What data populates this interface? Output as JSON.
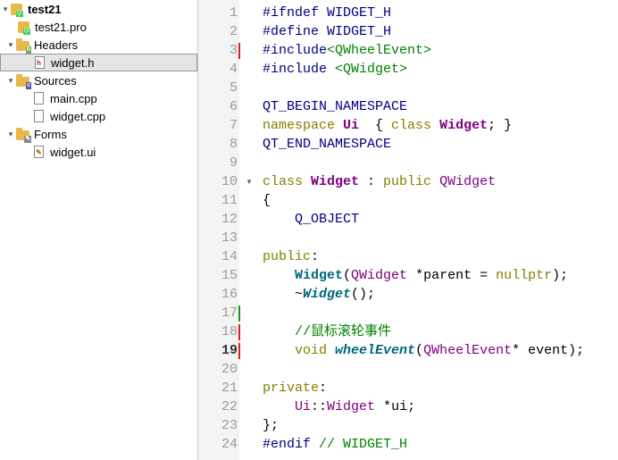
{
  "tree": {
    "project": "test21",
    "pro_file": "test21.pro",
    "headers_label": "Headers",
    "header_file": "widget.h",
    "sources_label": "Sources",
    "source_files": [
      "main.cpp",
      "widget.cpp"
    ],
    "forms_label": "Forms",
    "form_file": "widget.ui"
  },
  "editor": {
    "line_numbers": [
      "1",
      "2",
      "3",
      "4",
      "5",
      "6",
      "7",
      "8",
      "9",
      "10",
      "11",
      "12",
      "13",
      "14",
      "15",
      "16",
      "17",
      "18",
      "19",
      "20",
      "21",
      "22",
      "23",
      "24"
    ],
    "current_line": 19,
    "modified_lines_red": [
      3,
      18,
      19
    ],
    "added_lines_green": [
      17
    ],
    "fold_marker_line": 10,
    "lines": [
      [
        [
          "pp",
          "#ifndef WIDGET_H"
        ]
      ],
      [
        [
          "pp",
          "#define WIDGET_H"
        ]
      ],
      [
        [
          "pp",
          "#include"
        ],
        [
          "str",
          "<QWheelEvent>"
        ]
      ],
      [
        [
          "pp",
          "#include "
        ],
        [
          "str",
          "<QWidget>"
        ]
      ],
      [],
      [
        [
          "mac",
          "QT_BEGIN_NAMESPACE"
        ]
      ],
      [
        [
          "kw",
          "namespace "
        ],
        [
          "ty",
          "Ui"
        ],
        [
          "",
          "  { "
        ],
        [
          "kw",
          "class "
        ],
        [
          "ty",
          "Widget"
        ],
        [
          "",
          "; }"
        ]
      ],
      [
        [
          "mac",
          "QT_END_NAMESPACE"
        ]
      ],
      [],
      [
        [
          "kw",
          "class "
        ],
        [
          "ty",
          "Widget"
        ],
        [
          "",
          " : "
        ],
        [
          "kw",
          "public "
        ],
        [
          "cl",
          "QWidget"
        ]
      ],
      [
        [
          "",
          "{"
        ]
      ],
      [
        [
          "",
          "    "
        ],
        [
          "mac",
          "Q_OBJECT"
        ]
      ],
      [],
      [
        [
          "kw",
          "public"
        ],
        [
          "",
          ":"
        ]
      ],
      [
        [
          "",
          "    "
        ],
        [
          "fn",
          "Widget"
        ],
        [
          "",
          "("
        ],
        [
          "cl",
          "QWidget"
        ],
        [
          "",
          " *parent = "
        ],
        [
          "kw",
          "nullptr"
        ],
        [
          "",
          ");"
        ]
      ],
      [
        [
          "",
          "    ~"
        ],
        [
          "fi",
          "Widget"
        ],
        [
          "",
          "();"
        ]
      ],
      [],
      [
        [
          "",
          "    "
        ],
        [
          "cm",
          "//鼠标滚轮事件"
        ]
      ],
      [
        [
          "",
          "    "
        ],
        [
          "kw",
          "void "
        ],
        [
          "fi",
          "wheelEvent"
        ],
        [
          "",
          "("
        ],
        [
          "cl",
          "QWheelEvent"
        ],
        [
          "",
          "* event);"
        ]
      ],
      [],
      [
        [
          "kw",
          "private"
        ],
        [
          "",
          ":"
        ]
      ],
      [
        [
          "",
          "    "
        ],
        [
          "cl",
          "Ui"
        ],
        [
          "",
          "::"
        ],
        [
          "cl",
          "Widget"
        ],
        [
          "",
          " *ui;"
        ]
      ],
      [
        [
          "",
          "};"
        ]
      ],
      [
        [
          "pp",
          "#endif "
        ],
        [
          "cm",
          "// WIDGET_H"
        ]
      ]
    ]
  },
  "colors": {
    "modified": "#e02020",
    "added": "#1a9a1a"
  }
}
